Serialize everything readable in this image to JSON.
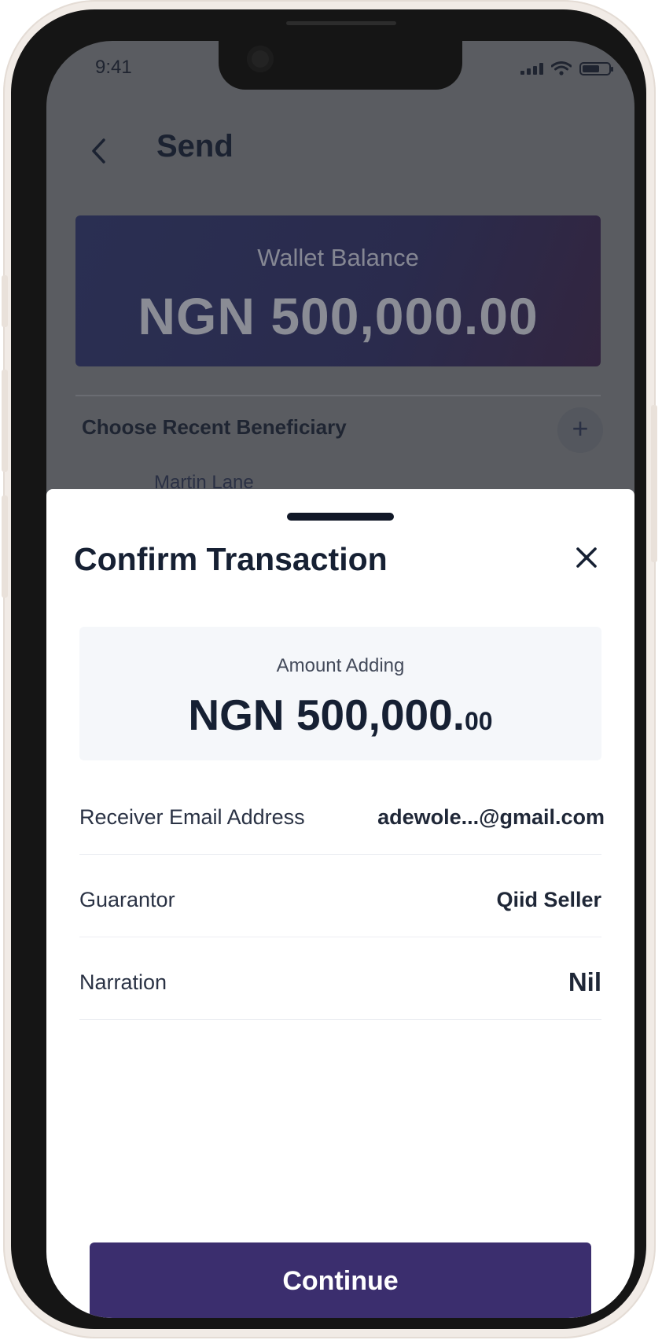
{
  "status_bar": {
    "time": "9:41"
  },
  "header": {
    "title": "Send"
  },
  "wallet": {
    "label": "Wallet Balance",
    "amount": "NGN 500,000.00"
  },
  "beneficiary": {
    "label": "Choose Recent Beneficiary",
    "add_symbol": "+",
    "peek_name": "Martin Lane"
  },
  "sheet": {
    "title": "Confirm Transaction",
    "amount_label": "Amount Adding",
    "amount_main": "NGN 500,000.",
    "amount_cents": "00",
    "details": [
      {
        "label": "Receiver Email Address",
        "value": "adewole...@gmail.com"
      },
      {
        "label": "Guarantor",
        "value": "Qiid Seller"
      },
      {
        "label": "Narration",
        "value": "Nil"
      }
    ],
    "continue_label": "Continue"
  }
}
